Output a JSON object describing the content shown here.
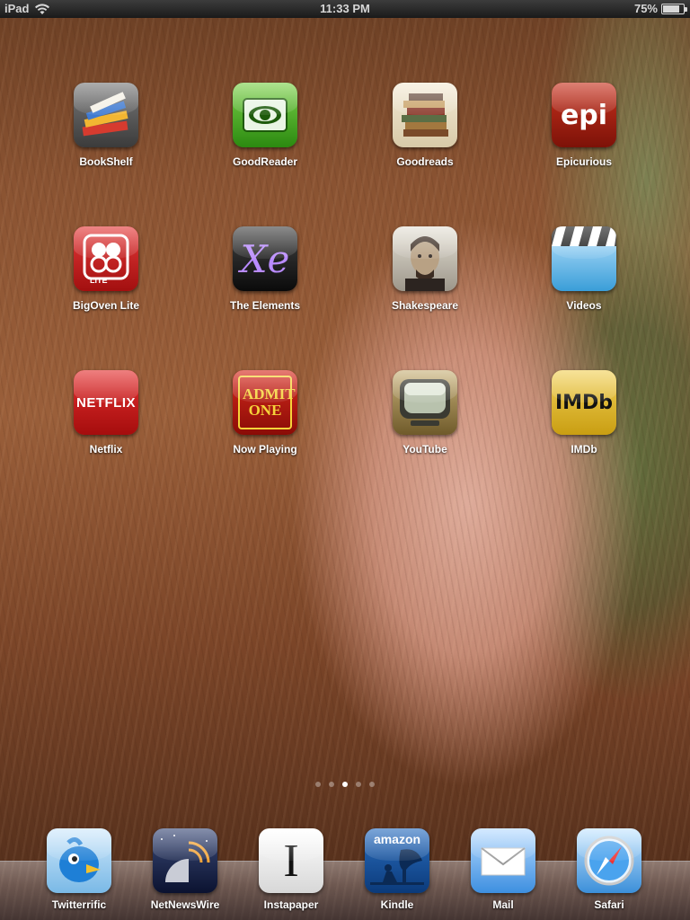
{
  "status_bar": {
    "device": "iPad",
    "time": "11:33 PM",
    "battery": "75%"
  },
  "home_screen": {
    "apps": [
      {
        "label": "BookShelf",
        "icon": "bookshelf-icon"
      },
      {
        "label": "GoodReader",
        "icon": "goodreader-eye-icon"
      },
      {
        "label": "Goodreads",
        "icon": "book-stack-icon"
      },
      {
        "label": "Epicurious",
        "icon": "epi-icon",
        "icon_text": "epi"
      },
      {
        "label": "BigOven Lite",
        "icon": "bigoven-icon",
        "icon_text": "LITE"
      },
      {
        "label": "The Elements",
        "icon": "elements-xe-icon",
        "icon_text": "Xe"
      },
      {
        "label": "Shakespeare",
        "icon": "shakespeare-portrait-icon"
      },
      {
        "label": "Videos",
        "icon": "clapperboard-icon"
      },
      {
        "label": "Netflix",
        "icon": "netflix-icon",
        "icon_text": "NETFLIX"
      },
      {
        "label": "Now Playing",
        "icon": "admit-one-ticket-icon",
        "icon_text": "ADMIT ONE"
      },
      {
        "label": "YouTube",
        "icon": "youtube-tv-icon"
      },
      {
        "label": "IMDb",
        "icon": "imdb-icon",
        "icon_text": "IMDb"
      }
    ],
    "page_indicator": {
      "pages": 5,
      "current": 3
    }
  },
  "dock": {
    "apps": [
      {
        "label": "Twitterrific",
        "icon": "bird-icon"
      },
      {
        "label": "NetNewsWire",
        "icon": "satellite-dish-icon"
      },
      {
        "label": "Instapaper",
        "icon": "instapaper-i-icon",
        "icon_text": "I"
      },
      {
        "label": "Kindle",
        "icon": "kindle-reader-icon",
        "icon_text": "amazon"
      },
      {
        "label": "Mail",
        "icon": "envelope-icon"
      },
      {
        "label": "Safari",
        "icon": "compass-icon"
      }
    ]
  },
  "colors": {
    "status_bar_bg": "#1a1a1a",
    "label_text": "#ffffff"
  }
}
